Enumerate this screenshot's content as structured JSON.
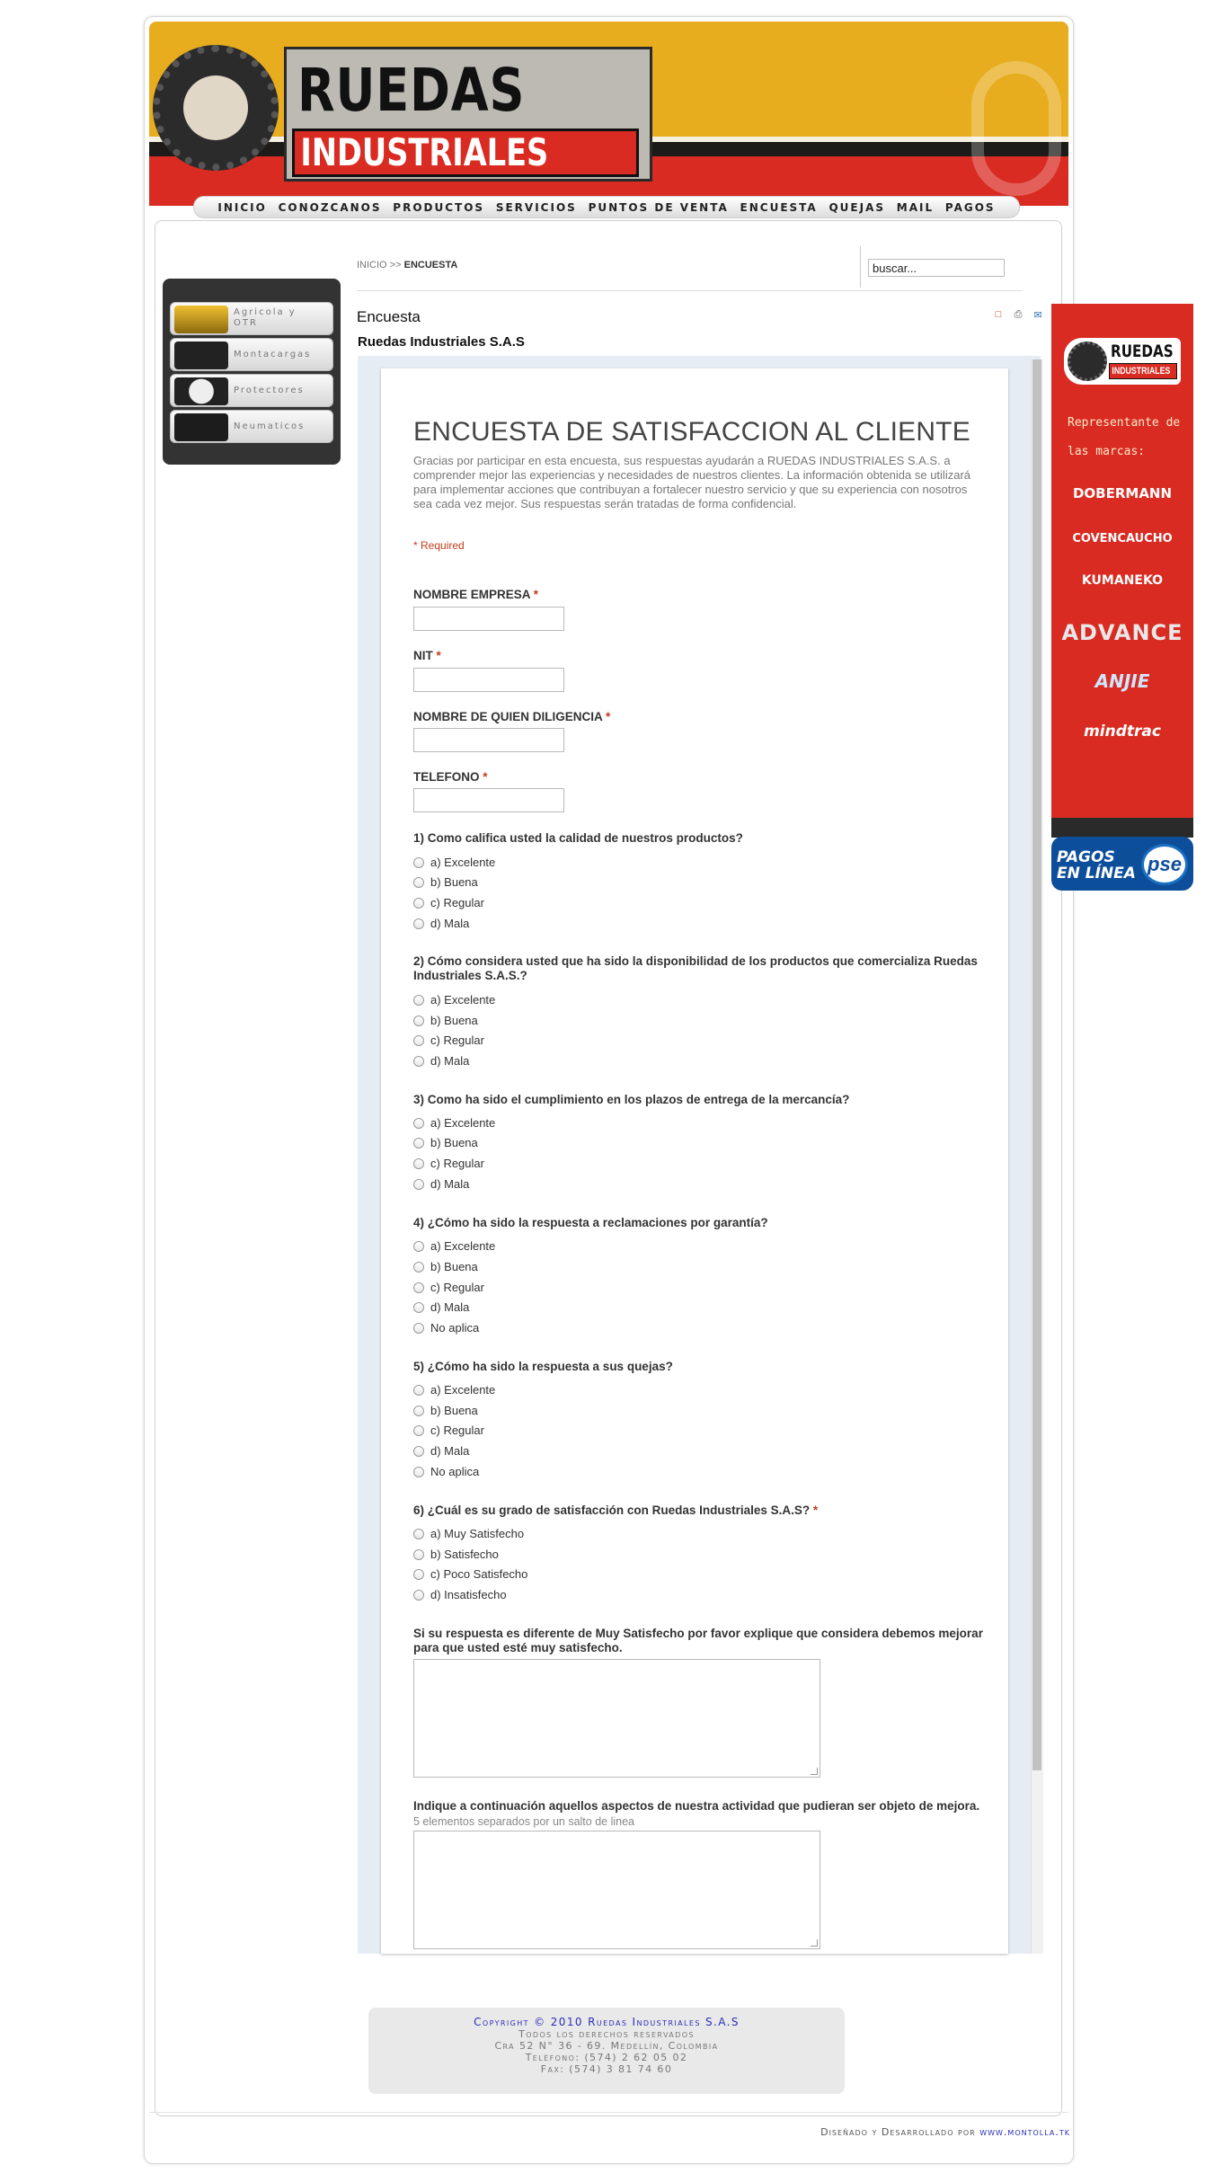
{
  "header": {
    "logo_top": "RUEDAS",
    "logo_bottom": "INDUSTRIALES"
  },
  "nav": [
    "INICIO",
    "CONOZCANOS",
    "PRODUCTOS",
    "SERVICIOS",
    "PUNTOS DE VENTA",
    "ENCUESTA",
    "QUEJAS",
    "MAIL",
    "PAGOS"
  ],
  "sidebar": {
    "items": [
      {
        "line1": "Agricola y",
        "line2": "OTR"
      },
      {
        "line1": "Montacargas",
        "line2": ""
      },
      {
        "line1": "Protectores",
        "line2": ""
      },
      {
        "line1": "Neumaticos",
        "line2": ""
      }
    ]
  },
  "breadcrumb": {
    "home": "INICIO",
    "sep": ">>",
    "current": "ENCUESTA"
  },
  "search": {
    "value": "buscar..."
  },
  "article": {
    "title": "Encuesta",
    "company": "Ruedas Industriales S.A.S"
  },
  "form": {
    "title": "ENCUESTA DE SATISFACCION AL CLIENTE",
    "description": "Gracias por participar en esta encuesta, sus respuestas ayudarán a RUEDAS INDUSTRIALES S.A.S. a comprender mejor las experiencias y necesidades de nuestros clientes. La información obtenida se utilizará para implementar acciones que contribuyan a fortalecer nuestro servicio y que su experiencia con nosotros sea cada vez mejor. Sus respuestas serán tratadas de forma confidencial.",
    "required_note": "* Required",
    "star": "*",
    "fields": [
      {
        "label": "NOMBRE EMPRESA",
        "required": true
      },
      {
        "label": "NIT",
        "required": true
      },
      {
        "label": "NOMBRE DE QUIEN DILIGENCIA",
        "required": true
      },
      {
        "label": "TELEFONO",
        "required": true
      }
    ],
    "questions": [
      {
        "label": "1) Como califica usted la calidad de nuestros productos?",
        "options": [
          "a) Excelente",
          "b) Buena",
          "c) Regular",
          "d) Mala"
        ]
      },
      {
        "label": "2) Cómo considera usted que ha sido la disponibilidad de los productos que comercializa Ruedas Industriales S.A.S.?",
        "options": [
          "a) Excelente",
          "b) Buena",
          "c) Regular",
          "d) Mala"
        ]
      },
      {
        "label": "3) Como ha sido el cumplimiento en los plazos de entrega de la mercancía?",
        "options": [
          "a) Excelente",
          "b) Buena",
          "c) Regular",
          "d) Mala"
        ]
      },
      {
        "label": "4) ¿Cómo ha sido la respuesta a reclamaciones por garantía?",
        "options": [
          "a) Excelente",
          "b) Buena",
          "c) Regular",
          "d) Mala",
          "No aplica"
        ]
      },
      {
        "label": "5) ¿Cómo ha sido la respuesta a sus quejas?",
        "options": [
          "a) Excelente",
          "b) Buena",
          "c) Regular",
          "d) Mala",
          "No aplica"
        ]
      },
      {
        "label": "6) ¿Cuál es su grado de satisfacción con Ruedas Industriales S.A.S?",
        "required": true,
        "options": [
          "a) Muy Satisfecho",
          "b) Satisfecho",
          "c) Poco Satisfecho",
          "d) Insatisfecho"
        ]
      }
    ],
    "textarea1_label": "Si su respuesta es diferente de Muy Satisfecho por favor explique que considera debemos mejorar para que usted esté muy satisfecho.",
    "textarea2_label": "Indique a continuación aquellos aspectos de nuestra actividad que pudieran ser objeto de mejora.",
    "textarea2_hint": "5 elementos separados por un salto de linea"
  },
  "banner": {
    "logo_top": "RUEDAS",
    "logo_bottom": "INDUSTRIALES",
    "subtitle": "Representante de las marcas:",
    "brands": [
      "DOBERMANN",
      "COVENCAUCHO",
      "KUMANEKO",
      "ADVANCE",
      "ANJIE",
      "mindtrac"
    ],
    "pse_text": "PAGOS EN LÍNEA",
    "pse_logo": "pse"
  },
  "footer": {
    "copyright": "Copyright © 2010 Ruedas Industriales S.A.S",
    "rights": "Todos los derechos reservados",
    "address": "Cra 52 N° 36 - 69. Medellín, Colombia",
    "phone": "Teléfono: (574) 2 62 05 02",
    "fax": "Fax: (574) 3 81 74 60",
    "credit_label": "Diseñado y Desarrollado por",
    "credit_link": "www.montolla.tk"
  }
}
